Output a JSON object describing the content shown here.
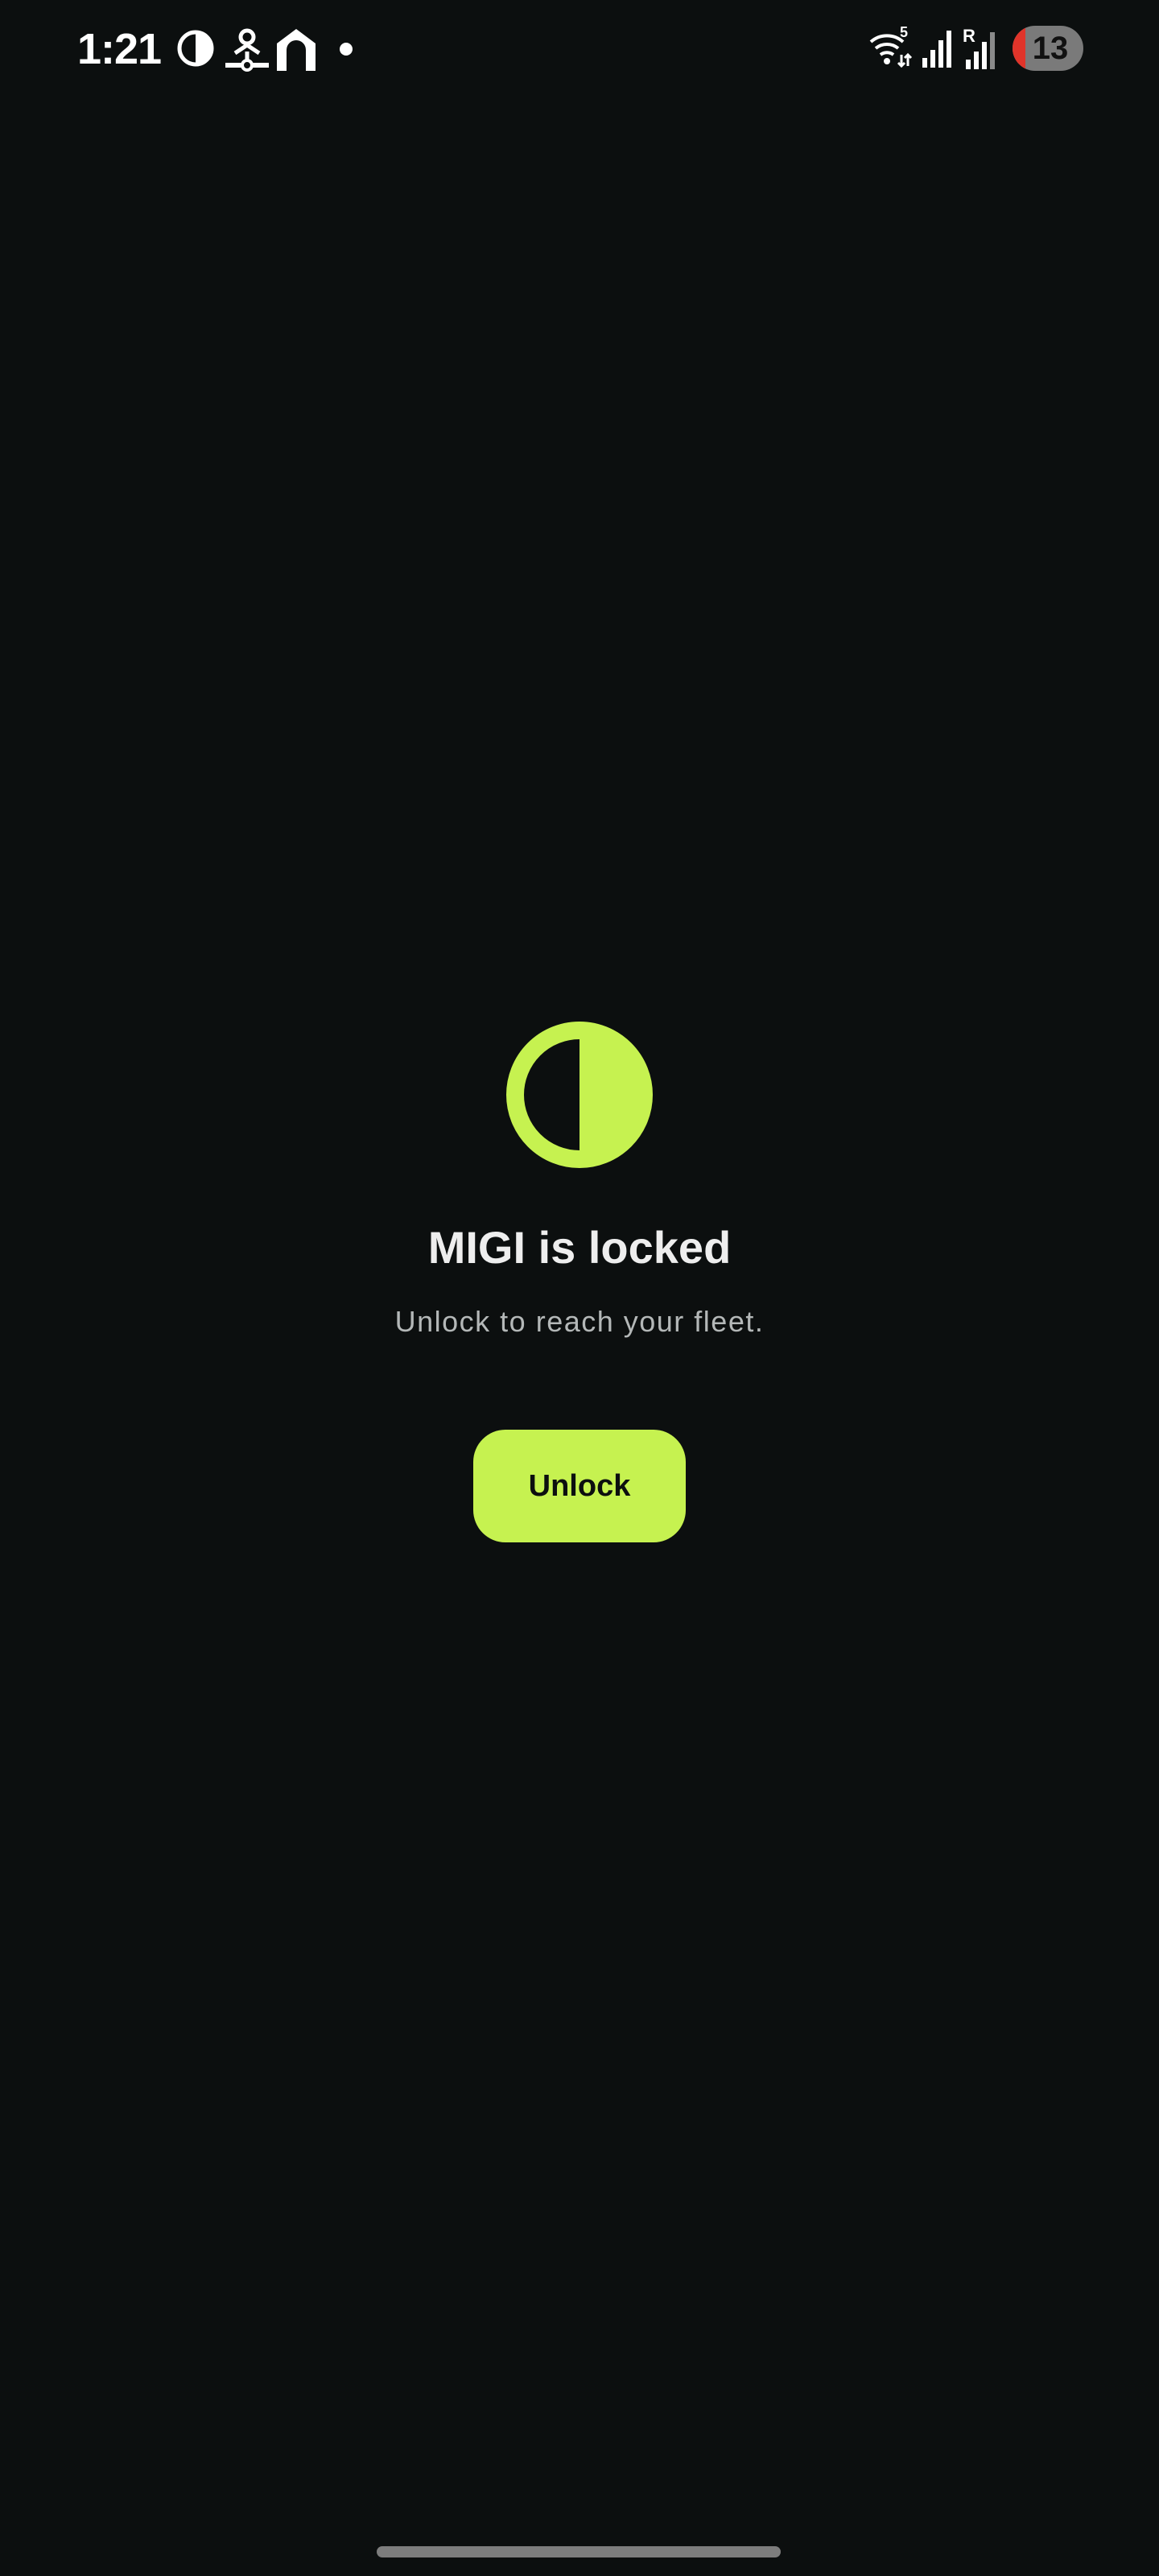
{
  "status_bar": {
    "time": "1:21",
    "battery_level": "13",
    "icons_left": [
      "contrast-icon",
      "device-network-icon",
      "home-icon",
      "notification-dot-icon"
    ],
    "icons_right": [
      "wifi-5-icon",
      "cellular-signal-icon",
      "roaming-signal-icon",
      "battery-icon"
    ]
  },
  "lock_screen": {
    "logo_icon": "half-circle-logo-icon",
    "title": "MIGI is locked",
    "subtitle": "Unlock to reach your fleet.",
    "unlock_label": "Unlock"
  },
  "colors": {
    "background": "#0c0f0f",
    "accent": "#c6f250",
    "title_text": "#eeeeee",
    "subtitle_text": "#b4b8b8",
    "battery_low": "#e0342a"
  }
}
